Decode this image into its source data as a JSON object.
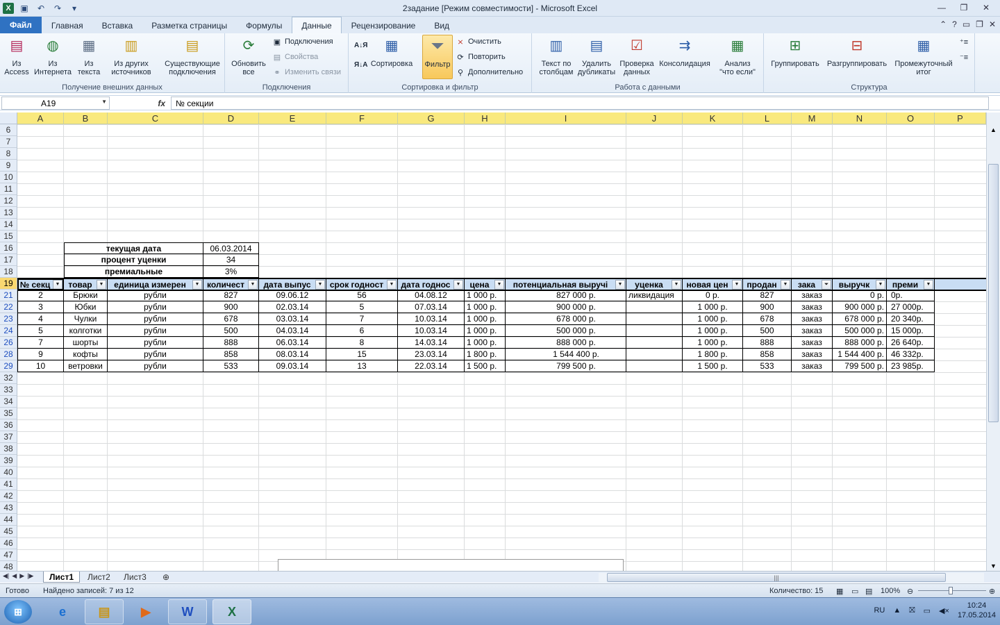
{
  "window": {
    "title": "2задание  [Режим совместимости]  -  Microsoft Excel"
  },
  "tabs": [
    "Файл",
    "Главная",
    "Вставка",
    "Разметка страницы",
    "Формулы",
    "Данные",
    "Рецензирование",
    "Вид"
  ],
  "ribbon": {
    "g1": {
      "label": "Получение внешних данных",
      "b1": "Из Access",
      "b2": "Из Интернета",
      "b3": "Из текста",
      "b4": "Из других источников",
      "b5": "Существующие подключения"
    },
    "g2": {
      "label": "Подключения",
      "refresh": "Обновить все",
      "conn": "Подключения",
      "props": "Свойства",
      "links": "Изменить связи"
    },
    "g3": {
      "label": "Сортировка и фильтр",
      "sort": "Сортировка",
      "filter": "Фильтр",
      "clear": "Очистить",
      "reapply": "Повторить",
      "advanced": "Дополнительно"
    },
    "g4": {
      "label": "Работа с данными",
      "t2c": "Текст по столбцам",
      "dup": "Удалить дубликаты",
      "valid": "Проверка данных",
      "cons": "Консолидация",
      "whatif": "Анализ \"что если\""
    },
    "g5": {
      "label": "Структура",
      "group": "Группировать",
      "ungroup": "Разгруппировать",
      "subtotal": "Промежуточный итог"
    }
  },
  "formula": {
    "namebox": "A19",
    "fx": "fx",
    "content": "№ секции"
  },
  "columns": [
    "A",
    "B",
    "C",
    "D",
    "E",
    "F",
    "G",
    "H",
    "I",
    "J",
    "K",
    "L",
    "M",
    "N",
    "O",
    "P"
  ],
  "rows_top": [
    "6",
    "7",
    "8",
    "9",
    "10",
    "11",
    "12",
    "13",
    "14",
    "15",
    "16",
    "17",
    "18",
    "19"
  ],
  "rows_data": [
    "21",
    "22",
    "23",
    "24",
    "26",
    "28",
    "29"
  ],
  "rows_bottom": [
    "32",
    "33",
    "34",
    "35",
    "36",
    "37",
    "38",
    "39",
    "40",
    "41",
    "42",
    "43",
    "44",
    "45",
    "46",
    "47",
    "48"
  ],
  "params": [
    {
      "label": "текущая дата",
      "value": "06.03.2014"
    },
    {
      "label": "процент уценки",
      "value": "34"
    },
    {
      "label": "премиальные",
      "value": "3%"
    }
  ],
  "headers": [
    "№ секц",
    "товар",
    "единица измерен",
    "количест",
    "дата выпус",
    "срок годност",
    "дата годнос",
    "цена",
    "потенциальная выручі",
    "уценка",
    "новая цен",
    "продан",
    "зака",
    "выручк",
    "преми"
  ],
  "table": [
    [
      "2",
      "Брюки",
      "рубли",
      "827",
      "09.06.12",
      "56",
      "04.08.12",
      "1 000 р.",
      "827 000 р.",
      "ликвидация",
      "0 р.",
      "827",
      "заказ",
      "0 р.",
      "0р."
    ],
    [
      "3",
      "Юбки",
      "рубли",
      "900",
      "02.03.14",
      "5",
      "07.03.14",
      "1 000 р.",
      "900 000 р.",
      "",
      "1 000 р.",
      "900",
      "заказ",
      "900 000 р.",
      "27 000р."
    ],
    [
      "4",
      "Чулки",
      "рубли",
      "678",
      "03.03.14",
      "7",
      "10.03.14",
      "1 000 р.",
      "678 000 р.",
      "",
      "1 000 р.",
      "678",
      "заказ",
      "678 000 р.",
      "20 340р."
    ],
    [
      "5",
      "колготки",
      "рубли",
      "500",
      "04.03.14",
      "6",
      "10.03.14",
      "1 000 р.",
      "500 000 р.",
      "",
      "1 000 р.",
      "500",
      "заказ",
      "500 000 р.",
      "15 000р."
    ],
    [
      "7",
      "шорты",
      "рубли",
      "888",
      "06.03.14",
      "8",
      "14.03.14",
      "1 000 р.",
      "888 000 р.",
      "",
      "1 000 р.",
      "888",
      "заказ",
      "888 000 р.",
      "26 640р."
    ],
    [
      "9",
      "кофты",
      "рубли",
      "858",
      "08.03.14",
      "15",
      "23.03.14",
      "1 800 р.",
      "1 544 400 р.",
      "",
      "1 800 р.",
      "858",
      "заказ",
      "1 544 400 р.",
      "46 332р."
    ],
    [
      "10",
      "ветровки",
      "рубли",
      "533",
      "09.03.14",
      "13",
      "22.03.14",
      "1 500 р.",
      "799 500 р.",
      "",
      "1 500 р.",
      "533",
      "заказ",
      "799 500 р.",
      "23 985р."
    ]
  ],
  "sheets": [
    "Лист1",
    "Лист2",
    "Лист3"
  ],
  "status": {
    "ready": "Готово",
    "found": "Найдено записей: 7 из 12",
    "count": "Количество: 15",
    "zoom": "100%"
  },
  "taskbar": {
    "lang": "RU",
    "time": "10:24",
    "date": "17.05.2014"
  },
  "colors": {
    "header_yellow": "#f9e97e",
    "table_header": "#c9ddf3",
    "file_tab": "#2f72c2"
  }
}
